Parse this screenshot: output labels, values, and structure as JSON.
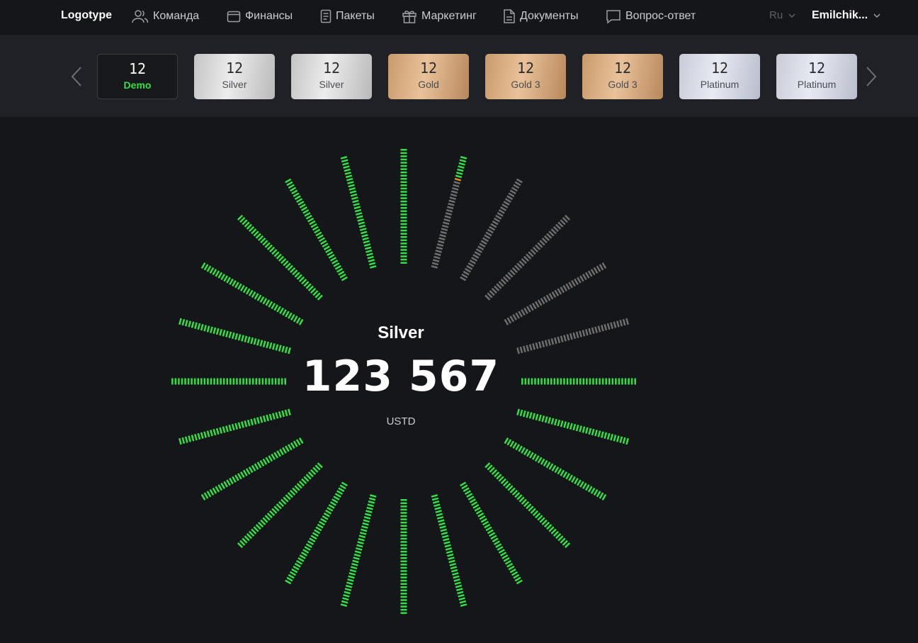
{
  "header": {
    "logo": "Logotype",
    "nav": [
      {
        "label": "Команда",
        "icon": "users-icon"
      },
      {
        "label": "Финансы",
        "icon": "wallet-icon"
      },
      {
        "label": "Пакеты",
        "icon": "list-icon"
      },
      {
        "label": "Маркетинг",
        "icon": "gift-icon"
      },
      {
        "label": "Документы",
        "icon": "document-icon"
      },
      {
        "label": "Вопрос-ответ",
        "icon": "chat-icon"
      }
    ],
    "language": "Ru",
    "user": "Emilchik..."
  },
  "packages": [
    {
      "number": "12",
      "name": "Demo",
      "style": "demo",
      "selected": true
    },
    {
      "number": "12",
      "name": "Silver",
      "style": "silver"
    },
    {
      "number": "12",
      "name": "Silver",
      "style": "silver"
    },
    {
      "number": "12",
      "name": "Gold",
      "style": "gold"
    },
    {
      "number": "12",
      "name": "Gold 3",
      "style": "gold"
    },
    {
      "number": "12",
      "name": "Gold 3",
      "style": "gold"
    },
    {
      "number": "12",
      "name": "Platinum",
      "style": "platinum"
    },
    {
      "number": "12",
      "name": "Platinum",
      "style": "platinum"
    }
  ],
  "gauge": {
    "title": "Silver",
    "value": "123 567",
    "unit": "USTD",
    "rays_total": 24,
    "rays_filled_before_partial": 19,
    "partial_ray_fill": 0.2,
    "colors": {
      "active": "#32e046",
      "inactive": "#6e6e6e",
      "progress_tip": "#e2882a",
      "background": "#151619"
    }
  }
}
